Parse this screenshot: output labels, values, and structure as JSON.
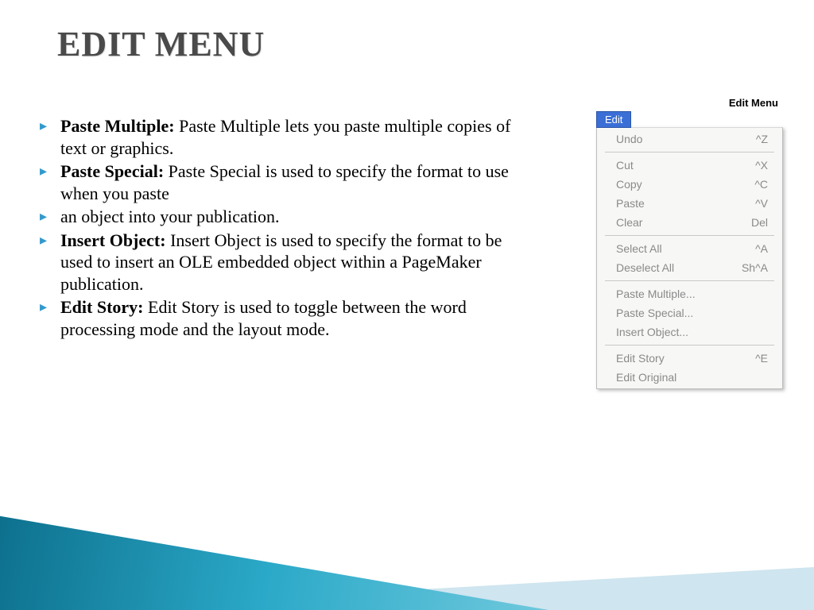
{
  "title": "EDIT MENU",
  "bullets": [
    {
      "term": "Paste Multiple:",
      "desc": " Paste Multiple lets you paste multiple copies of text or graphics."
    },
    {
      "term": "Paste Special:",
      "desc": " Paste Special is used to specify the format to use when you paste"
    },
    {
      "term": "",
      "desc": "an object into your publication."
    },
    {
      "term": "Insert Object:",
      "desc": " Insert Object is used to specify the format to be used to insert an OLE embedded object within a PageMaker publication."
    },
    {
      "term": "Edit Story:",
      "desc": " Edit Story is used to toggle between the word processing mode and the layout mode."
    }
  ],
  "menu": {
    "caption": "Edit Menu",
    "tab": "Edit",
    "groups": [
      [
        {
          "label": "Undo",
          "shortcut": "^Z"
        }
      ],
      [
        {
          "label": "Cut",
          "shortcut": "^X"
        },
        {
          "label": "Copy",
          "shortcut": "^C"
        },
        {
          "label": "Paste",
          "shortcut": "^V"
        },
        {
          "label": "Clear",
          "shortcut": "Del"
        }
      ],
      [
        {
          "label": "Select All",
          "shortcut": "^A"
        },
        {
          "label": "Deselect All",
          "shortcut": "Sh^A"
        }
      ],
      [
        {
          "label": "Paste Multiple...",
          "shortcut": ""
        },
        {
          "label": "Paste Special...",
          "shortcut": ""
        },
        {
          "label": "Insert Object...",
          "shortcut": ""
        }
      ],
      [
        {
          "label": "Edit Story",
          "shortcut": "^E"
        },
        {
          "label": "Edit Original",
          "shortcut": ""
        }
      ]
    ]
  }
}
